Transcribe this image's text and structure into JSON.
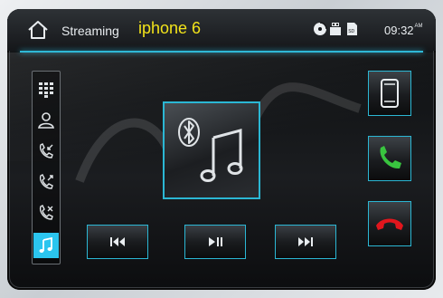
{
  "header": {
    "source_label": "Streaming",
    "device_name": "iphone 6",
    "time": "09:32",
    "time_suffix": "AM",
    "icons": [
      "disc-icon",
      "usb-icon",
      "sd-card-icon"
    ]
  },
  "sidebar": {
    "items": [
      {
        "name": "keypad-icon",
        "active": false
      },
      {
        "name": "contacts-icon",
        "active": false
      },
      {
        "name": "incoming-call-icon",
        "active": false
      },
      {
        "name": "outgoing-call-icon",
        "active": false
      },
      {
        "name": "missed-call-icon",
        "active": false
      },
      {
        "name": "music-icon",
        "active": true
      }
    ]
  },
  "colors": {
    "accent": "#2bc5ef",
    "device_name": "#f2e31a",
    "answer": "#39c43f",
    "hangup": "#e2161d"
  },
  "transport": [
    "previous-track-icon",
    "play-pause-icon",
    "next-track-icon"
  ],
  "right_buttons": [
    "phone-device-icon",
    "answer-call-icon",
    "end-call-icon"
  ]
}
